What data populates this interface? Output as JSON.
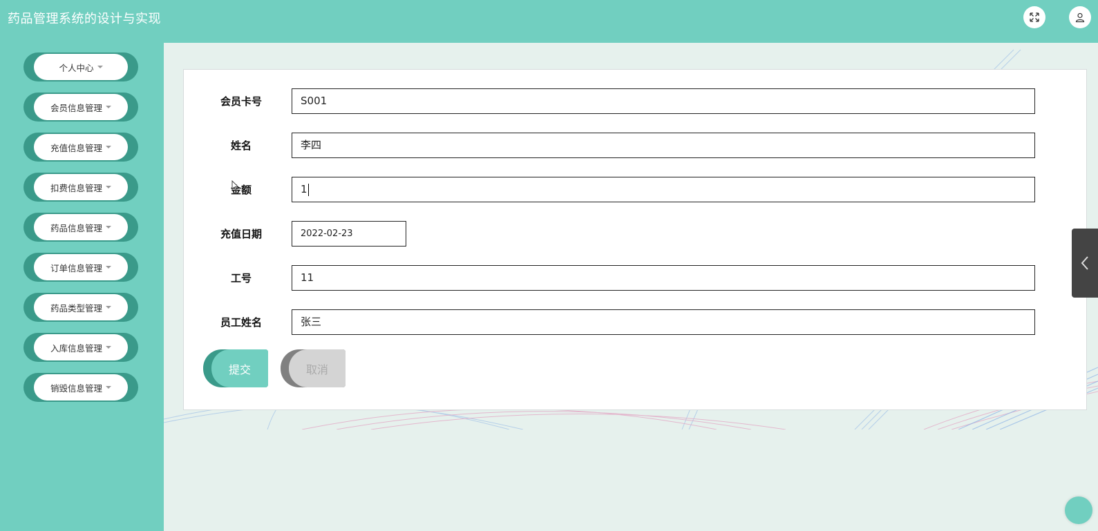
{
  "header": {
    "title": "药品管理系统的设计与实现",
    "icons": [
      "fullscreen-icon",
      "user-icon"
    ]
  },
  "sidebar": {
    "items": [
      {
        "label": "个人中心"
      },
      {
        "label": "会员信息管理"
      },
      {
        "label": "充值信息管理"
      },
      {
        "label": "扣费信息管理"
      },
      {
        "label": "药品信息管理"
      },
      {
        "label": "订单信息管理"
      },
      {
        "label": "药品类型管理"
      },
      {
        "label": "入库信息管理"
      },
      {
        "label": "销毁信息管理"
      }
    ]
  },
  "form": {
    "fields": [
      {
        "label": "会员卡号",
        "value": "S001"
      },
      {
        "label": "姓名",
        "value": "李四"
      },
      {
        "label": "金额",
        "value": "1"
      },
      {
        "label": "充值日期",
        "value": "2022-02-23"
      },
      {
        "label": "工号",
        "value": "11"
      },
      {
        "label": "员工姓名",
        "value": "张三"
      }
    ],
    "submit_label": "提交",
    "cancel_label": "取消"
  },
  "colors": {
    "primary": "#71cfc0",
    "primary_dark": "#3a9a8a",
    "background": "#e6f1ed"
  }
}
